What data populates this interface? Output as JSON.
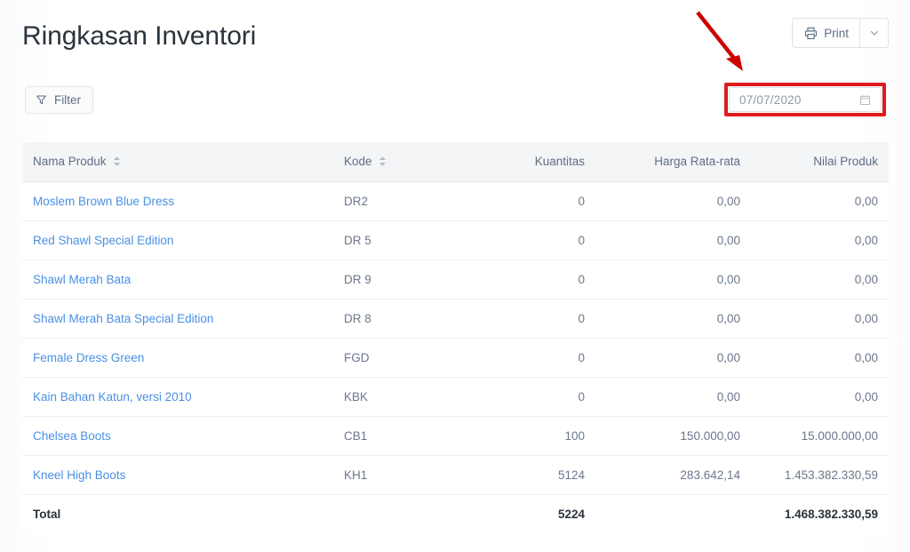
{
  "header": {
    "title": "Ringkasan Inventori",
    "print_label": "Print",
    "print_icon": "printer-icon",
    "print_caret_icon": "chevron-down-icon"
  },
  "toolbar": {
    "filter_label": "Filter",
    "filter_icon": "funnel-icon"
  },
  "date_filter": {
    "value": "07/07/2020",
    "calendar_icon": "calendar-icon",
    "highlight_color": "#e01b1b"
  },
  "annotation": {
    "arrow_color": "#cc0000",
    "arrow_name": "red-annotation-arrow",
    "box_name": "red-annotation-box"
  },
  "table": {
    "columns": [
      {
        "label": "Nama Produk",
        "align": "left",
        "sortable": true
      },
      {
        "label": "Kode",
        "align": "left",
        "sortable": true
      },
      {
        "label": "Kuantitas",
        "align": "right",
        "sortable": false
      },
      {
        "label": "Harga Rata-rata",
        "align": "right",
        "sortable": false
      },
      {
        "label": "Nilai Produk",
        "align": "right",
        "sortable": false
      }
    ],
    "rows": [
      {
        "name": "Moslem Brown Blue Dress",
        "kode": "DR2",
        "kuantitas": "0",
        "harga": "0,00",
        "nilai": "0,00"
      },
      {
        "name": "Red Shawl Special Edition",
        "kode": "DR 5",
        "kuantitas": "0",
        "harga": "0,00",
        "nilai": "0,00"
      },
      {
        "name": "Shawl Merah Bata",
        "kode": "DR 9",
        "kuantitas": "0",
        "harga": "0,00",
        "nilai": "0,00"
      },
      {
        "name": "Shawl Merah Bata Special Edition",
        "kode": "DR 8",
        "kuantitas": "0",
        "harga": "0,00",
        "nilai": "0,00"
      },
      {
        "name": "Female Dress Green",
        "kode": "FGD",
        "kuantitas": "0",
        "harga": "0,00",
        "nilai": "0,00"
      },
      {
        "name": "Kain Bahan Katun, versi 2010",
        "kode": "KBK",
        "kuantitas": "0",
        "harga": "0,00",
        "nilai": "0,00"
      },
      {
        "name": "Chelsea Boots",
        "kode": "CB1",
        "kuantitas": "100",
        "harga": "150.000,00",
        "nilai": "15.000.000,00"
      },
      {
        "name": "Kneel High Boots",
        "kode": "KH1",
        "kuantitas": "5124",
        "harga": "283.642,14",
        "nilai": "1.453.382.330,59"
      }
    ],
    "total": {
      "label": "Total",
      "kode": "",
      "kuantitas": "5224",
      "harga": "",
      "nilai": "1.468.382.330,59"
    }
  }
}
